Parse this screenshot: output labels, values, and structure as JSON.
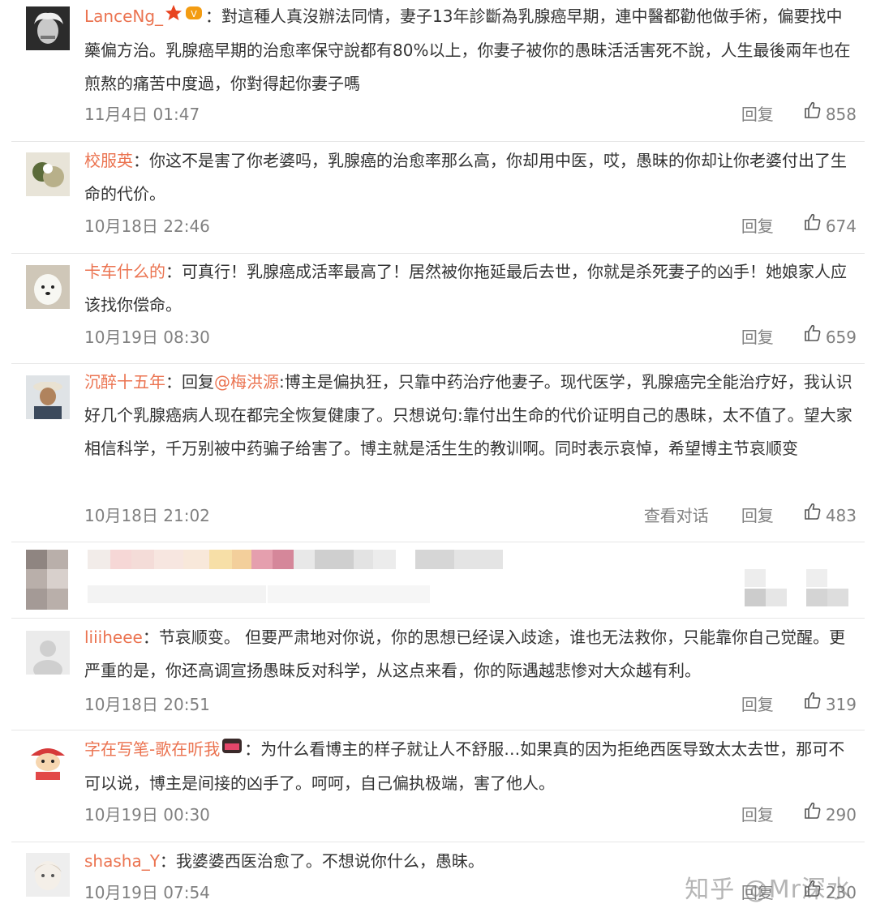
{
  "reply_label": "回复",
  "view_conversation_label": "查看对话",
  "watermark": "知乎 @Mr深水",
  "colors": {
    "username": "#eb7350",
    "meta": "#808080",
    "text": "#333333"
  },
  "comments": [
    {
      "username": "LanceNg_",
      "text": "：對這種人真沒辦法同情，妻子13年診斷為乳腺癌早期，連中醫都勸他做手術，偏要找中藥偏方治。乳腺癌早期的治愈率保守說都有80%以上，你妻子被你的愚昧活活害死不說，人生最後兩年也在煎熬的痛苦中度過，你對得起你妻子嗎",
      "time": "11月4日 01:47",
      "likes": "858",
      "avatar_icon": "portrait-avatar"
    },
    {
      "username": "校服英",
      "text": "：你这不是害了你老婆吗，乳腺癌的治愈率那么高，你却用中医，哎，愚昧的你却让你老婆付出了生命的代价。",
      "time": "10月18日 22:46",
      "likes": "674",
      "avatar_icon": "cartoon-avatar"
    },
    {
      "username": "卡车什么的",
      "text": "：可真行！乳腺癌成活率最高了！居然被你拖延最后去世，你就是杀死妻子的凶手！她娘家人应该找你偿命。",
      "time": "10月19日 08:30",
      "likes": "659",
      "avatar_icon": "dog-avatar"
    },
    {
      "username": "沉醉十五年",
      "pre": "：回复",
      "mention": "@梅洪源",
      "text": ":博主是偏执狂，只靠中药治疗他妻子。现代医学，乳腺癌完全能治疗好，我认识好几个乳腺癌病人现在都完全恢复健康了。只想说句:靠付出生命的代价证明自己的愚昧，太不值了。望大家相信科学，千万别被中药骗子给害了。博主就是活生生的教训啊。同时表示哀悼，希望博主节哀顺变",
      "time": "10月18日 21:02",
      "likes": "483",
      "avatar_icon": "hat-man-avatar"
    },
    {
      "username": "liiiheee",
      "text": "：节哀顺变。 但要严肃地对你说，你的思想已经误入歧途，谁也无法救你，只能靠你自己觉醒。更严重的是，你还高调宣扬愚昧反对科学，从这点来看，你的际遇越悲惨对大众越有利。",
      "time": "10月18日 20:51",
      "likes": "319",
      "avatar_icon": "default-avatar"
    },
    {
      "username": "字在写笔-歌在听我",
      "text": "：为什么看博主的样子就让人不舒服…如果真的因为拒绝西医导致太太去世，那可不可以说，博主是间接的凶手了。呵呵，自己偏执极端，害了他人。",
      "time": "10月19日 00:30",
      "likes": "290",
      "avatar_icon": "cartoon-boy-avatar"
    },
    {
      "username": "shasha_Y",
      "text": "：我婆婆西医治愈了。不想说你什么，愚昧。",
      "time": "10月19日 07:54",
      "likes": "230",
      "avatar_icon": "girl-avatar"
    }
  ]
}
